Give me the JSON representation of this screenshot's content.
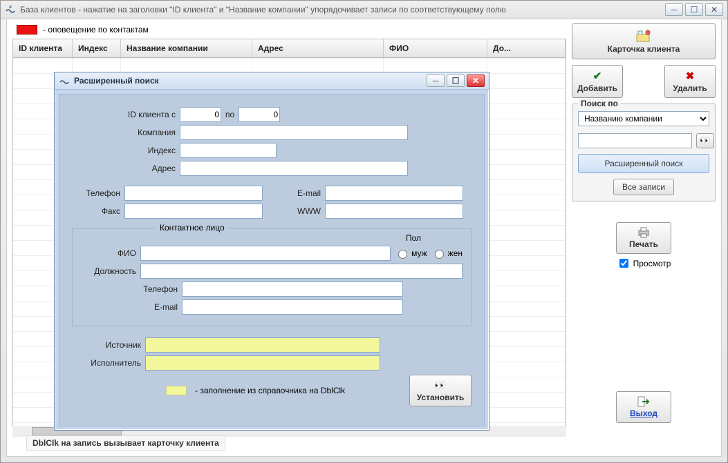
{
  "window": {
    "title": "База клиентов - нажатие на заголовки \"ID клиента\" и \"Название компании\" упорядочивает записи по соответствующему полю"
  },
  "legend": {
    "text": "- оповещение по контактам"
  },
  "columns": {
    "id": "ID клиента",
    "index": "Индекс",
    "company": "Название компании",
    "address": "Адрес",
    "fio": "ФИО",
    "pos": "До..."
  },
  "hint": "DblClk на запись вызывает карточку клиента",
  "side": {
    "card": "Карточка клиента",
    "add": "Добавить",
    "delete": "Удалить",
    "search_label": "Поиск по",
    "search_option": "Названию компании",
    "adv_search": "Расширенный поиск",
    "all_records": "Все записи",
    "print": "Печать",
    "preview": "Просмотр",
    "exit": "Выход"
  },
  "modal": {
    "title": "Расширенный поиск",
    "id_from_lbl": "ID клиента с",
    "id_from": "0",
    "id_to_lbl": "по",
    "id_to": "0",
    "company_lbl": "Компания",
    "index_lbl": "Индекс",
    "address_lbl": "Адрес",
    "phone_lbl": "Телефон",
    "email_lbl": "E-mail",
    "fax_lbl": "Факс",
    "www_lbl": "WWW",
    "contact_title": "Контактное лицо",
    "fio_lbl": "ФИО",
    "gender_lbl": "Пол",
    "gender_m": "муж",
    "gender_f": "жен",
    "position_lbl": "Должность",
    "cphone_lbl": "Телефон",
    "cemail_lbl": "E-mail",
    "source_lbl": "Источник",
    "performer_lbl": "Исполнитель",
    "dblclk_hint": "- заполнение из справочника на DblClk",
    "apply": "Установить"
  }
}
